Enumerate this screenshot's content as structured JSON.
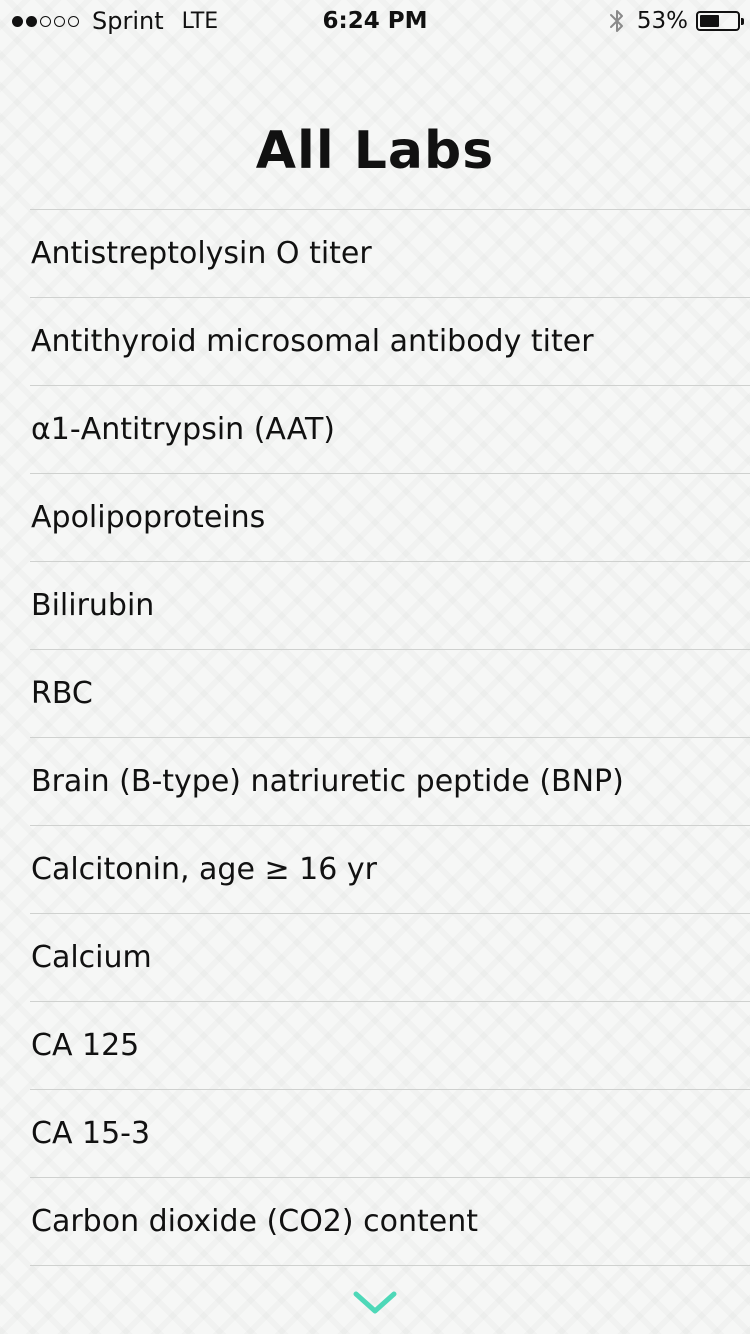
{
  "status_bar": {
    "carrier": "Sprint",
    "network": "LTE",
    "time": "6:24 PM",
    "battery_percent": "53%",
    "battery_level": 0.53,
    "signal_bars_filled": 2,
    "signal_bars_total": 5,
    "icons": [
      "signal-dots-icon",
      "bluetooth-icon",
      "battery-icon"
    ]
  },
  "header": {
    "title": "All Labs"
  },
  "labs": [
    "Antistreptolysin O titer",
    "Antithyroid microsomal antibody titer",
    "α1-Antitrypsin (AAT)",
    "Apolipoproteins",
    "Bilirubin",
    "RBC",
    "Brain (B-type) natriuretic peptide (BNP)",
    "Calcitonin, age ≥ 16 yr",
    "Calcium",
    "CA 125",
    "CA 15-3",
    "Carbon dioxide (CO2) content"
  ],
  "scroll_indicator": {
    "icon": "chevron-down-icon",
    "color": "#4ed8b8"
  },
  "colors": {
    "background": "#f6f7f6",
    "text": "#111111",
    "divider": "#cfd1cf",
    "accent": "#4ed8b8"
  }
}
